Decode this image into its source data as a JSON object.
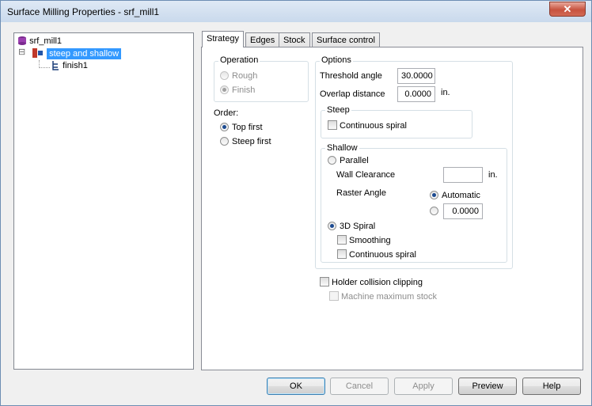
{
  "window": {
    "title": "Surface Milling Properties - srf_mill1",
    "close_glyph": "✕"
  },
  "tree": {
    "root": "srf_mill1",
    "child": "steep and shallow",
    "grandchild": "finish1",
    "expander": "⊟"
  },
  "tabs": [
    "Strategy",
    "Edges",
    "Stock",
    "Surface control"
  ],
  "strategy": {
    "operation": {
      "title": "Operation",
      "rough": "Rough",
      "finish": "Finish"
    },
    "order": {
      "title": "Order:",
      "top_first": "Top first",
      "steep_first": "Steep first"
    },
    "options": {
      "title": "Options",
      "threshold_label": "Threshold angle",
      "threshold_value": "30.0000",
      "overlap_label": "Overlap distance",
      "overlap_value": "0.0000",
      "overlap_unit": "in."
    },
    "steep": {
      "title": "Steep",
      "continuous_spiral": "Continuous spiral"
    },
    "shallow": {
      "title": "Shallow",
      "parallel": "Parallel",
      "wall_clearance": "Wall Clearance",
      "wall_unit": "in.",
      "raster_angle": "Raster Angle",
      "automatic": "Automatic",
      "raster_value": "0.0000",
      "spiral_3d": "3D Spiral",
      "smoothing": "Smoothing",
      "continuous_spiral": "Continuous spiral"
    },
    "holder_clipping": "Holder collision clipping",
    "machine_max_stock": "Machine maximum stock"
  },
  "buttons": {
    "ok": "OK",
    "cancel": "Cancel",
    "apply": "Apply",
    "preview": "Preview",
    "help": "Help"
  },
  "colors": {
    "selection": "#3399ff",
    "titlebar": "#dfe9f5",
    "close": "#c7533f"
  }
}
